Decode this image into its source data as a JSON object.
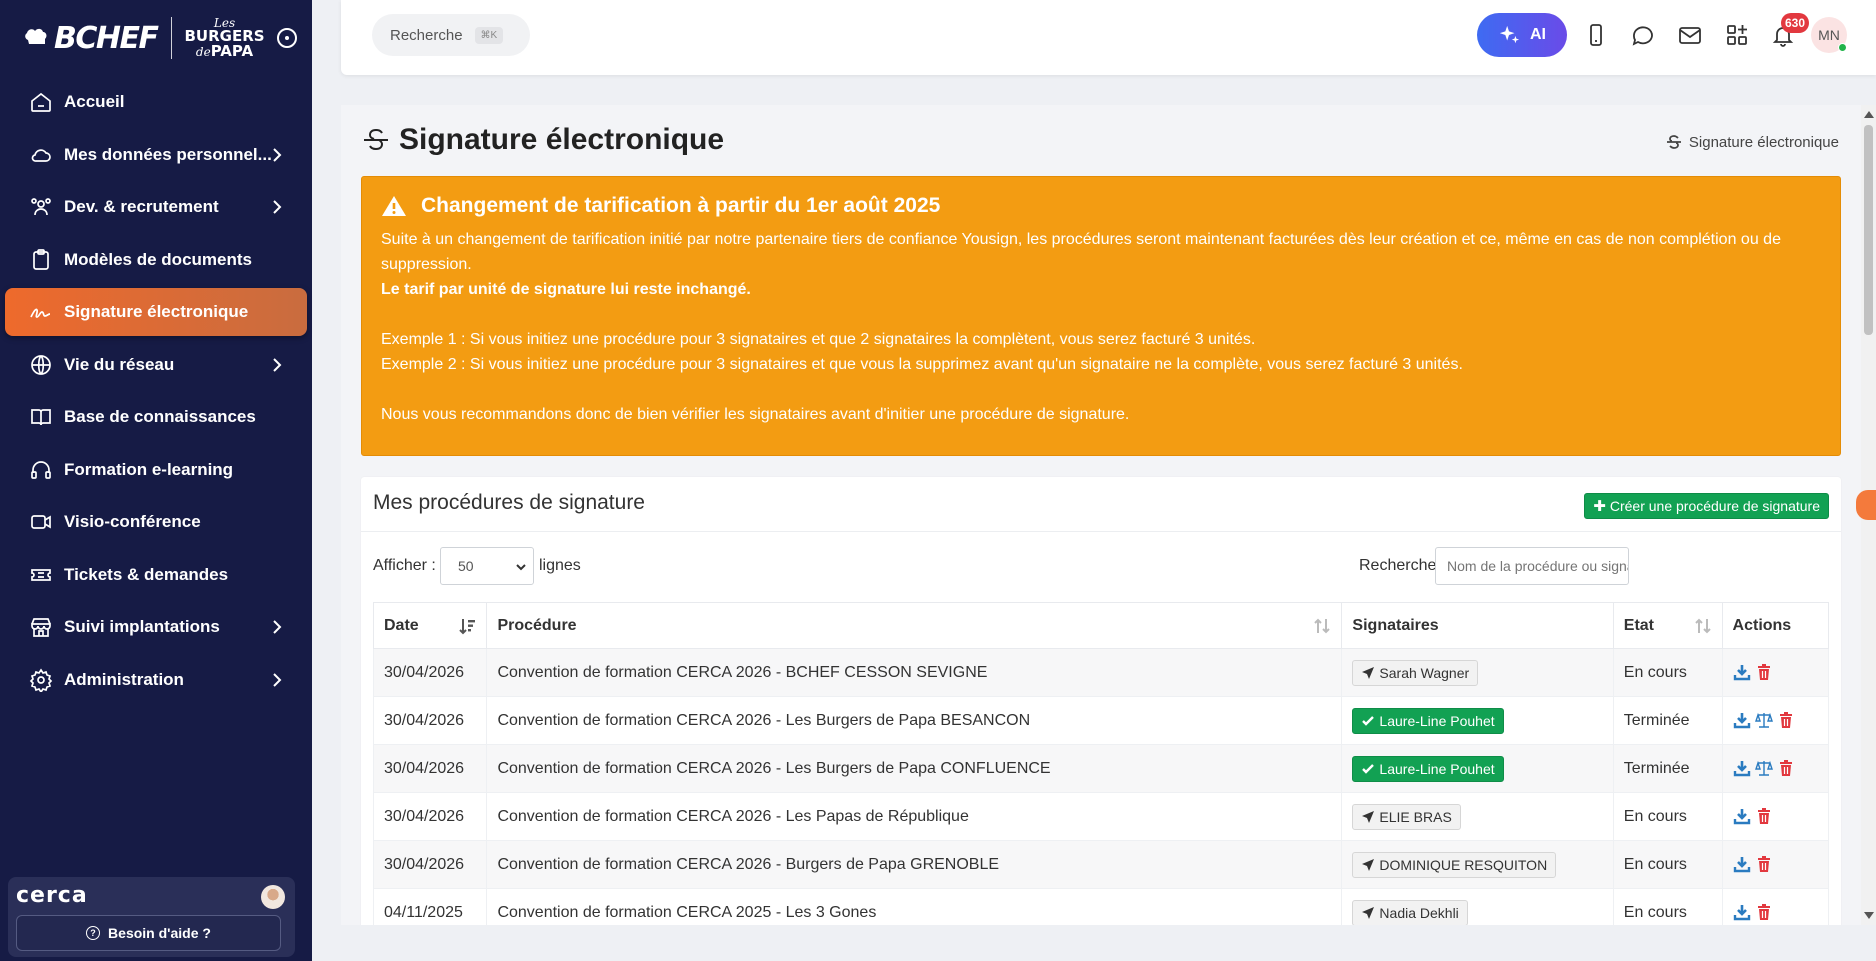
{
  "brand": {
    "main": "BCHEF",
    "partner_top": "Les",
    "partner_mid": "BURGERS",
    "partner_bot_small": "de",
    "partner_bot": "PAPA"
  },
  "sidebar": {
    "items": [
      {
        "label": "Accueil",
        "icon": "home-icon",
        "chevron": false,
        "active": false
      },
      {
        "label": "Mes données personnel...",
        "icon": "cloud-icon",
        "chevron": true,
        "active": false
      },
      {
        "label": "Dev. & recrutement",
        "icon": "users-icon",
        "chevron": true,
        "active": false
      },
      {
        "label": "Modèles de documents",
        "icon": "clipboard-icon",
        "chevron": false,
        "active": false
      },
      {
        "label": "Signature électronique",
        "icon": "signature-icon",
        "chevron": false,
        "active": true
      },
      {
        "label": "Vie du réseau",
        "icon": "globe-icon",
        "chevron": true,
        "active": false
      },
      {
        "label": "Base de connaissances",
        "icon": "book-icon",
        "chevron": false,
        "active": false
      },
      {
        "label": "Formation e-learning",
        "icon": "headphones-icon",
        "chevron": false,
        "active": false
      },
      {
        "label": "Visio-conférence",
        "icon": "video-icon",
        "chevron": false,
        "active": false
      },
      {
        "label": "Tickets & demandes",
        "icon": "ticket-icon",
        "chevron": false,
        "active": false
      },
      {
        "label": "Suivi implantations",
        "icon": "store-icon",
        "chevron": true,
        "active": false
      },
      {
        "label": "Administration",
        "icon": "gear-icon",
        "chevron": true,
        "active": false
      }
    ],
    "footer": {
      "logo": "cerca",
      "help": "Besoin d'aide ?"
    }
  },
  "topbar": {
    "search_label": "Recherche",
    "search_shortcut": "⌘K",
    "ai_label": "AI",
    "notification_count": "630",
    "user_initials": "MN"
  },
  "page": {
    "title": "Signature électronique",
    "breadcrumb": "Signature électronique"
  },
  "alert": {
    "title": "Changement de tarification à partir du 1er août 2025",
    "line1": "Suite à un changement de tarification initié par notre partenaire tiers de confiance Yousign, les procédures seront maintenant facturées dès leur création et ce, même en cas de non complétion ou de suppression.",
    "line2": "Le tarif par unité de signature lui reste inchangé.",
    "line3": "Exemple 1 : Si vous initiez une procédure pour 3 signataires et que 2 signataires la complètent, vous serez facturé 3 unités.",
    "line4": "Exemple 2 : Si vous initiez une procédure pour 3 signataires et que vous la supprimez avant qu'un signataire ne la complète, vous serez facturé 3 unités.",
    "line5": "Nous vous recommandons donc de bien vérifier les signataires avant d'initier une procédure de signature."
  },
  "procedures": {
    "title": "Mes procédures de signature",
    "create_button": "Créer une procédure de signature",
    "show_label": "Afficher :",
    "page_size": "50",
    "lines_label": "lignes",
    "search_label": "Recherche",
    "search_placeholder": "Nom de la procédure ou signataire",
    "columns": [
      "Date",
      "Procédure",
      "Signataires",
      "Etat",
      "Actions"
    ],
    "rows": [
      {
        "date": "30/04/2026",
        "procedure": "Convention de formation CERCA 2026 - BCHEF CESSON SEVIGNE",
        "signer": "Sarah Wagner",
        "signer_status": "sent",
        "etat": "En cours",
        "actions": [
          "download",
          "delete"
        ]
      },
      {
        "date": "30/04/2026",
        "procedure": "Convention de formation CERCA 2026 - Les Burgers de Papa BESANCON",
        "signer": "Laure-Line Pouhet",
        "signer_status": "done",
        "etat": "Terminée",
        "actions": [
          "download",
          "proof",
          "delete"
        ]
      },
      {
        "date": "30/04/2026",
        "procedure": "Convention de formation CERCA 2026 - Les Burgers de Papa CONFLUENCE",
        "signer": "Laure-Line Pouhet",
        "signer_status": "done",
        "etat": "Terminée",
        "actions": [
          "download",
          "proof",
          "delete"
        ]
      },
      {
        "date": "30/04/2026",
        "procedure": "Convention de formation CERCA 2026 - Les Papas de République",
        "signer": "ELIE BRAS",
        "signer_status": "sent",
        "etat": "En cours",
        "actions": [
          "download",
          "delete"
        ]
      },
      {
        "date": "30/04/2026",
        "procedure": "Convention de formation CERCA 2026 - Burgers de Papa GRENOBLE",
        "signer": "DOMINIQUE RESQUITON",
        "signer_status": "sent",
        "etat": "En cours",
        "actions": [
          "download",
          "delete"
        ]
      },
      {
        "date": "04/11/2025",
        "procedure": "Convention de formation CERCA 2025 - Les 3 Gones",
        "signer": "Nadia Dekhli",
        "signer_status": "sent",
        "etat": "En cours",
        "actions": [
          "download",
          "delete"
        ]
      }
    ]
  },
  "colors": {
    "sidebar_bg": "#161b45",
    "active": "#ee6a2c",
    "alert": "#f39c12",
    "success": "#12a153",
    "danger": "#e2383f",
    "link": "#2a7bc0"
  }
}
